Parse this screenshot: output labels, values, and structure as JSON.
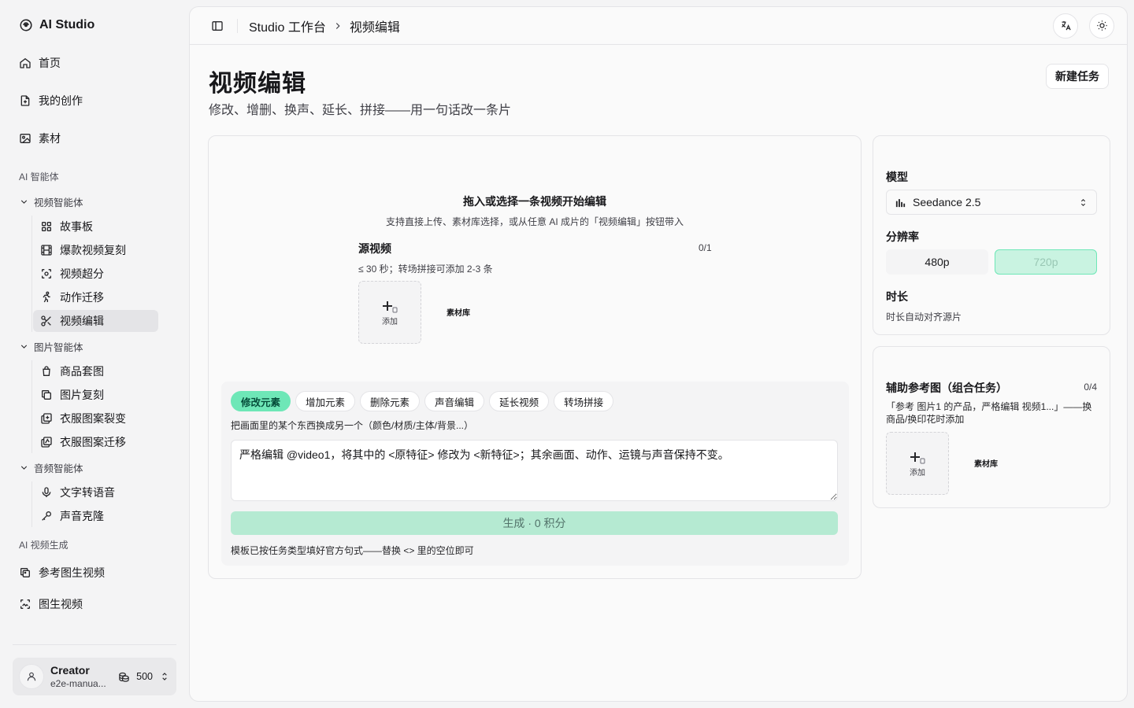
{
  "sidebar": {
    "brand": "AI Studio",
    "top_items": [
      {
        "label": "首页"
      },
      {
        "label": "我的创作"
      },
      {
        "label": "素材"
      }
    ],
    "section_agents": "AI 智能体",
    "video_group": "视频智能体",
    "video_items": [
      "故事板",
      "爆款视频复刻",
      "视频超分",
      "动作迁移",
      "视频编辑"
    ],
    "image_group": "图片智能体",
    "image_items": [
      "商品套图",
      "图片复刻",
      "衣服图案裂变",
      "衣服图案迁移"
    ],
    "audio_group": "音频智能体",
    "audio_items": [
      "文字转语音",
      "声音克隆"
    ],
    "section_gen": "AI 视频生成",
    "gen_items": [
      "参考图生视频",
      "图生视频"
    ],
    "user": {
      "name": "Creator",
      "email": "e2e-manua...",
      "credits": "500"
    }
  },
  "header": {
    "crumb_root": "Studio 工作台",
    "crumb_current": "视频编辑"
  },
  "page": {
    "title": "视频编辑",
    "subtitle": "修改、增删、换声、延长、拼接——用一句话改一条片",
    "new_task": "新建任务"
  },
  "upload_panel": {
    "headline": "拖入或选择一条视频开始编辑",
    "hint": "支持直接上传、素材库选择，或从任意 AI 成片的「视频编辑」按钮带入",
    "source_label": "源视频",
    "source_count": "0/1",
    "source_limit": "≤ 30 秒；转场拼接可添加 2-3 条",
    "add_label": "添加",
    "library_label": "素材库"
  },
  "editor": {
    "tabs": [
      "修改元素",
      "增加元素",
      "删除元素",
      "声音编辑",
      "延长视频",
      "转场拼接"
    ],
    "active_tab": 0,
    "tab_hint": "把画面里的某个东西换成另一个（颜色/材质/主体/背景...）",
    "prompt_value": "严格编辑 @video1，将其中的 <原特征> 修改为 <新特征>；其余画面、动作、运镜与声音保持不变。",
    "generate_label": "生成 · 0 积分",
    "footer_hint": "模板已按任务类型填好官方句式——替换 <> 里的空位即可"
  },
  "settings": {
    "model_label": "模型",
    "model_value": "Seedance 2.5",
    "resolution_label": "分辨率",
    "resolutions": [
      "480p",
      "720p"
    ],
    "selected_resolution": "720p",
    "duration_label": "时长",
    "duration_value": "时长自动对齐源片"
  },
  "reference": {
    "title": "辅助参考图（组合任务）",
    "count": "0/4",
    "hint": "「参考 图片1 的产品，严格编辑 视频1...」——换商品/换印花时添加",
    "add_label": "添加",
    "library_label": "素材库"
  },
  "colors": {
    "accent": "#6ee7b7",
    "accent_light": "#b5ead2",
    "active_bg": "#e4e4e7"
  }
}
